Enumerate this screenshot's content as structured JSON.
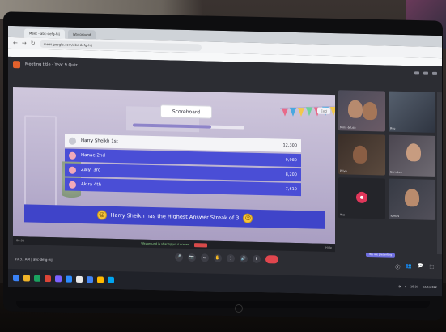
{
  "browser": {
    "tabs": [
      "Meet - abc-defg-hij",
      "Wayground"
    ],
    "url": "meet.google.com/abc-defg-hij"
  },
  "meeting": {
    "title": "Meeting title - Year 9 Quiz",
    "clock": "10:31 AM | abc-defg-hij"
  },
  "quiz": {
    "header": "Scoreboard",
    "close_label": "End",
    "progress_fraction": 0.7,
    "leaderboard": [
      {
        "name": "Harry Sheikh 1st",
        "score": "12,300"
      },
      {
        "name": "Hanae 2nd",
        "score": "9,980"
      },
      {
        "name": "Zaiyi 3rd",
        "score": "8,200"
      },
      {
        "name": "Akira 4th",
        "score": "7,610"
      }
    ],
    "banner": "Harry Sheikh has the Highest Answer Streak of 3"
  },
  "stagebar": {
    "left": "00:05",
    "center": "Wayground is sharing your screen",
    "stop": "Stop sharing",
    "right": "Hide"
  },
  "participants": [
    {
      "name": "Mina & Lea"
    },
    {
      "name": "Ryo"
    },
    {
      "name": "Priya"
    },
    {
      "name": "Sam Lee"
    },
    {
      "name": "You"
    },
    {
      "name": "Tomas"
    }
  ],
  "controls": {
    "presenting": "You are presenting",
    "buttons": [
      "🎤",
      "📷",
      "▭",
      "✋",
      "⋮",
      "🔊",
      "⬆"
    ],
    "right": [
      "ⓘ",
      "👥",
      "💬",
      "⬚"
    ]
  },
  "taskbar": {
    "tray_time": "10:31",
    "tray_date": "12/5/2022",
    "colors": [
      "#3a82f7",
      "#f0b429",
      "#1aa260",
      "#db4437",
      "#7b61ff",
      "#2d8cff",
      "#e8e8e8",
      "#4285f4",
      "#ffb900",
      "#00a4ef"
    ]
  },
  "colors": {
    "leaderboard_row": "#4a4ed6",
    "banner": "#3f44c9",
    "end_call": "#e0464e"
  }
}
